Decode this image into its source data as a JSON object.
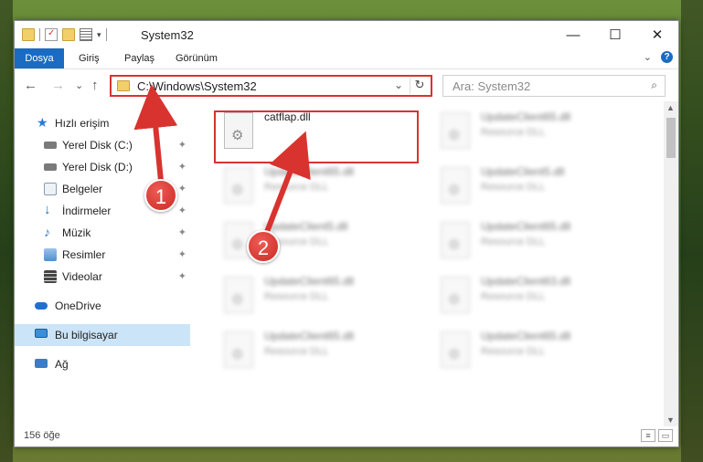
{
  "titlebar": {
    "title": "System32",
    "minimize": "—",
    "maximize": "☐",
    "close": "✕"
  },
  "ribbon": {
    "tabs": [
      {
        "label": "Dosya",
        "active": true
      },
      {
        "label": "Giriş"
      },
      {
        "label": "Paylaş"
      },
      {
        "label": "Görünüm"
      }
    ],
    "expand_glyph": "⌄",
    "help_glyph": "?"
  },
  "nav": {
    "back": "←",
    "forward": "→",
    "recent": "⌄",
    "up": "↑",
    "address": "C:\\Windows\\System32",
    "address_dropdown": "⌄",
    "refresh": "↻",
    "search_placeholder": "Ara: System32",
    "search_icon": "⌕"
  },
  "sidebar": {
    "items": [
      {
        "label": "Hızlı erişim",
        "icon": "star-icon",
        "color": "#2a7bd5"
      },
      {
        "label": "Yerel Disk (C:)",
        "icon": "drive-icon",
        "color": "#7a7a7a",
        "pinned": true
      },
      {
        "label": "Yerel Disk (D:)",
        "icon": "drive-icon",
        "color": "#7a7a7a",
        "pinned": true
      },
      {
        "label": "Belgeler",
        "icon": "documents-icon",
        "color": "#9aa8b8",
        "pinned": true
      },
      {
        "label": "İndirmeler",
        "icon": "downloads-icon",
        "color": "#1f6fd1",
        "pinned": true
      },
      {
        "label": "Müzik",
        "icon": "music-icon",
        "color": "#2a7bd5",
        "pinned": true
      },
      {
        "label": "Resimler",
        "icon": "pictures-icon",
        "color": "#5a8fc7",
        "pinned": true
      },
      {
        "label": "Videolar",
        "icon": "videos-icon",
        "color": "#4a4a4a",
        "pinned": true
      },
      {
        "label": "OneDrive",
        "icon": "cloud-icon",
        "color": "#1f6fd1"
      },
      {
        "label": "Bu bilgisayar",
        "icon": "computer-icon",
        "color": "#3a8fd8",
        "selected": true
      },
      {
        "label": "Ağ",
        "icon": "network-icon",
        "color": "#3a7cc7"
      }
    ],
    "pin_glyph": "📌"
  },
  "files": [
    {
      "name": "catflap.dll",
      "type": "",
      "highlighted": true
    },
    {
      "name": "UpdateClient65.dll",
      "type": "Resource DLL"
    },
    {
      "name": "UpdateClient65.dll",
      "type": "Resource DLL"
    },
    {
      "name": "UpdateClient5.dll",
      "type": "Resource DLL"
    },
    {
      "name": "UpdateClient5.dll",
      "type": "Resource DLL"
    },
    {
      "name": "UpdateClient65.dll",
      "type": "Resource DLL"
    },
    {
      "name": "UpdateClient65.dll",
      "type": "Resource DLL"
    },
    {
      "name": "UpdateClient63.dll",
      "type": "Resource DLL"
    },
    {
      "name": "UpdateClient65.dll",
      "type": "Resource DLL"
    },
    {
      "name": "UpdateClient65.dll",
      "type": "Resource DLL"
    }
  ],
  "status": {
    "count": "156 öğe"
  },
  "badges": {
    "one": "1",
    "two": "2"
  },
  "colors": {
    "accent": "#1a6bc2",
    "annotation": "#d9332f",
    "selection": "#cce4f7"
  }
}
